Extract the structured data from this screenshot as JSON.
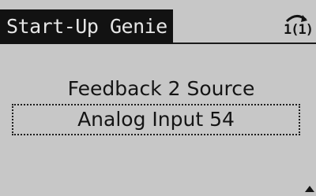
{
  "screen": {
    "title": "Start-Up Genie",
    "status_icon": {
      "name": "setup-indicator-icon",
      "label": "1(1)"
    },
    "parameter": {
      "name": "Feedback 2 Source",
      "value": "Analog Input 54"
    },
    "scroll_indicator": "scroll-up-arrow-icon"
  },
  "colors": {
    "lcd_background": "#c7c7c7",
    "title_bar_background": "#121212",
    "title_text": "#e6e6e6",
    "text": "#141414"
  }
}
